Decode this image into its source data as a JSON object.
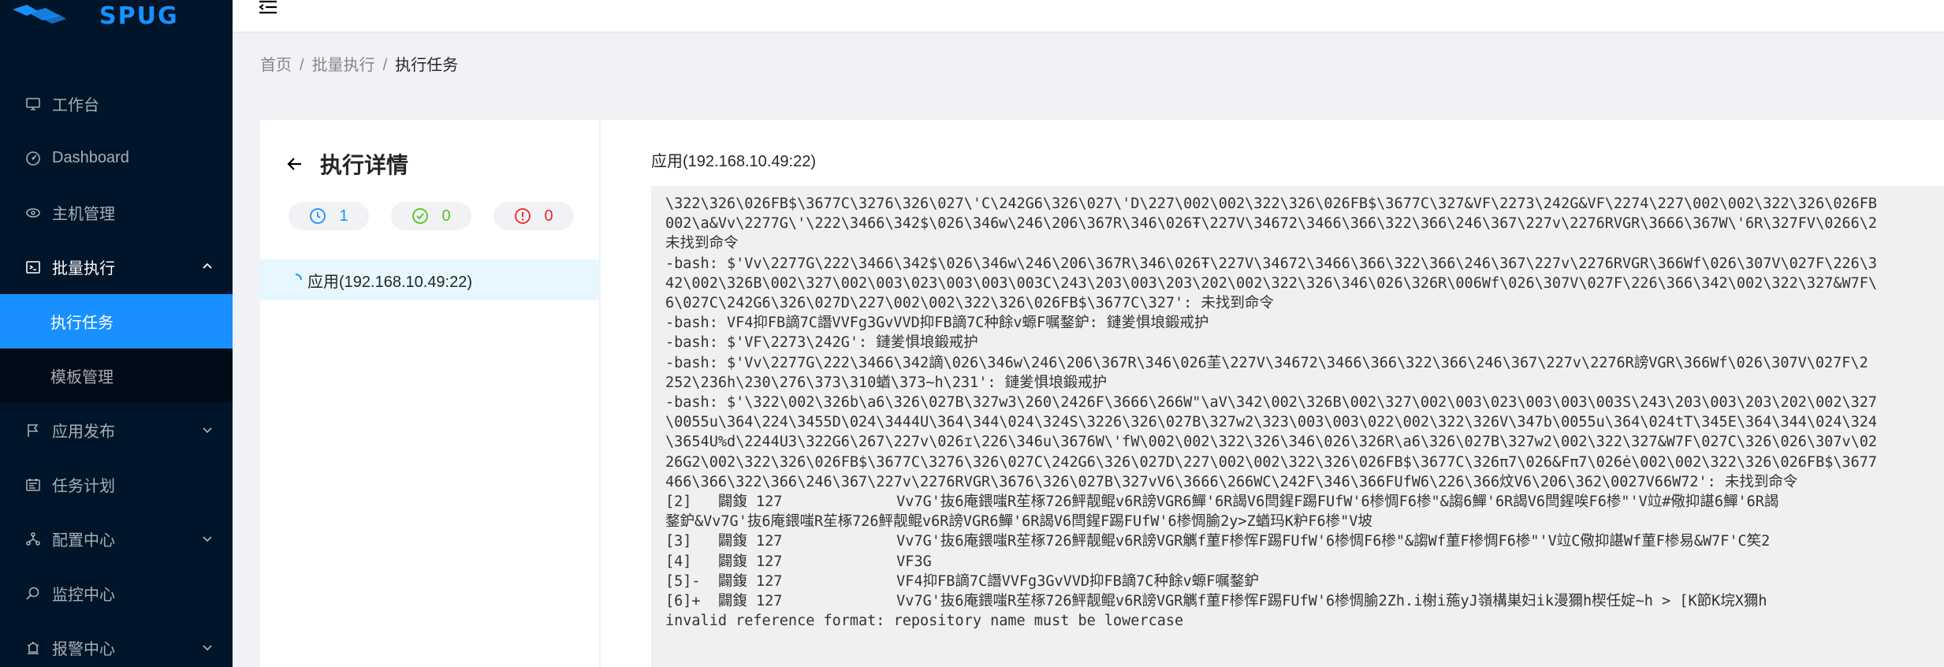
{
  "sidebar": {
    "logo_text": "SPUG",
    "items": [
      {
        "label": "工作台",
        "icon": "desktop-icon"
      },
      {
        "label": "Dashboard",
        "icon": "dashboard-icon"
      },
      {
        "label": "主机管理",
        "icon": "cloud-server-icon"
      },
      {
        "label": "批量执行",
        "icon": "code-icon",
        "open": true,
        "children": [
          {
            "label": "执行任务",
            "active": true
          },
          {
            "label": "模板管理",
            "active": false
          }
        ]
      },
      {
        "label": "应用发布",
        "icon": "flag-icon",
        "chevron": true
      },
      {
        "label": "任务计划",
        "icon": "schedule-icon"
      },
      {
        "label": "配置中心",
        "icon": "deployment-icon",
        "chevron": true
      },
      {
        "label": "监控中心",
        "icon": "monitor-search-icon"
      },
      {
        "label": "报警中心",
        "icon": "alert-icon",
        "chevron": true
      }
    ]
  },
  "breadcrumb": [
    "首页",
    "批量执行",
    "执行任务"
  ],
  "breadcrumb_sep": "/",
  "detail": {
    "title": "执行详情",
    "stats": {
      "running": "1",
      "success": "0",
      "failed": "0"
    },
    "host_label": "应用(192.168.10.49:22)"
  },
  "output": {
    "title": "应用(192.168.10.49:22)",
    "lines": [
      "\\322\\326\\026FB$\\3677C\\3276\\326\\027\\'C\\242G6\\326\\027\\'D\\227\\002\\002\\322\\326\\026FB$\\3677C\\327&VF\\2273\\242G&VF\\2274\\227\\002\\002\\322\\326\\026FB",
      "002\\a&Vv\\2277G\\'\\222\\3466\\342$\\026\\346w\\246\\206\\367R\\346\\026Ŧ\\227V\\34672\\3466\\366\\322\\366\\246\\367\\227v\\2276RVGR\\3666\\367W\\'6R\\327FV\\0266\\2",
      "未找到命令",
      "-bash: $'Vv\\2277G\\222\\3466\\342$\\026\\346w\\246\\206\\367R\\346\\026Ŧ\\227V\\34672\\3466\\366\\322\\366\\246\\367\\227v\\2276RVGR\\366Wf\\026\\307V\\027F\\226\\3",
      "42\\002\\326B\\002\\327\\002\\003\\023\\003\\003\\003C\\243\\203\\003\\203\\202\\002\\322\\326\\346\\026\\326R\\006Wf\\026\\307V\\027F\\226\\366\\342\\002\\322\\327&W7F\\",
      "6\\027C\\242G6\\326\\027D\\227\\002\\002\\322\\326\\026FB$\\3677C\\327': 未找到命令",
      "-bash: VF4抑FB謫7C譖VVFg3GvVVD抑FB謫7C种餘v螈F嘱鍪鈩: 鏈夎惧埌鍛戒护",
      "-bash: $'VF\\2273\\242G': 鏈夎惧埌鍛戒护",
      "-bash: $'Vv\\2277G\\222\\3466\\342謫\\026\\346w\\246\\206\\367R\\346\\026茥\\227V\\34672\\3466\\366\\322\\366\\246\\367\\227v\\2276R謗VGR\\366Wf\\026\\307V\\027F\\2",
      "252\\236h\\230\\276\\373\\310蝤\\373~h\\231': 鏈夎惧埌鍛戒护",
      "-bash: $'\\322\\002\\326b\\a6\\326\\027B\\327w3\\260\\2426F\\3666\\266W\"\\aV\\342\\002\\326B\\002\\327\\002\\003\\023\\003\\003\\003S\\243\\203\\003\\203\\202\\002\\327",
      "\\0055u\\364\\224\\3455D\\024\\3444U\\364\\344\\024\\324S\\3226\\326\\027B\\327w2\\323\\003\\003\\022\\002\\322\\326V\\347b\\0055u\\364\\024tT\\345E\\364\\344\\024\\324",
      "\\3654U%d\\2244U3\\322G6\\267\\227v\\026ɪ\\226\\346u\\3676W\\'fW\\002\\002\\322\\326\\346\\026\\326R\\a6\\326\\027B\\327w2\\002\\322\\327&W7F\\027C\\326\\026\\307v\\02",
      "26G2\\002\\322\\326\\026FB$\\3677C\\3276\\326\\027C\\242G6\\326\\027D\\227\\002\\002\\322\\326\\026FB$\\3677C\\326π7\\026&Fπ7\\026ė\\002\\002\\322\\326\\026FB$\\3677",
      "466\\366\\322\\366\\246\\367\\227v\\2276RVGR\\3676\\326\\027B\\327vV6\\3666\\266WC\\242F\\346\\366FUfW6\\226\\366炆V6\\206\\362\\0027V66W72': 未找到命令",
      "[2]   闢鍑 127             Vv7G'抜6庵鍡嗤R苼椓726鮃靓鲲v6R謗VGR6鱓'6R謁V6閆鍟F踢FUfW'6椮惆F6椮\"&謅6鱓'6R謁V6閆鍟唉F6椮\"'V竝#儆抑諶6鱓'6R謁",
      "鍪鈩&Vv7G'抜6庵鍡嗤R苼椓726鮃靓鲲v6R謗VGR6鱓'6R謁V6閆鍟F踢FUfW'6椮惆腧2y>Z蝤玛K粐F6椮\"V坡",
      "[3]   闢鍑 127             Vv7G'抜6庵鍡嗤R苼椓726鮃靓鲲v6R謗VGR觽f菫F椮恽F踢FUfW'6椮惆F6椮\"&謅Wf菫F椮惆F6椮\"'V竝C儆抑諶Wf菫F椮易&W7F'C笶2",
      "[4]   闢鍑 127             VF3G",
      "[5]-  闢鍑 127             VF4抑FB謫7C譖VVFg3GvVVD抑FB謫7C种餘v螈F嘱鍪鈩",
      "[6]+  闢鍑 127             Vv7G'抜6庵鍡嗤R苼椓726鮃靓鲲v6R謗VGR觽f菫F椮恽F踢FUfW'6椮惆腧2Zh.i榭i葹yJ嶺構巣妇ik漫獮h楔任婝~h > [K節K垸X獮h",
      "invalid reference format: repository name must be lowercase"
    ]
  },
  "colors": {
    "sidebar_bg": "#001529",
    "submenu_bg": "#000c17",
    "primary": "#1890ff",
    "success": "#52c41a",
    "error": "#f5222d",
    "terminal_bg": "#f0f0f0"
  }
}
